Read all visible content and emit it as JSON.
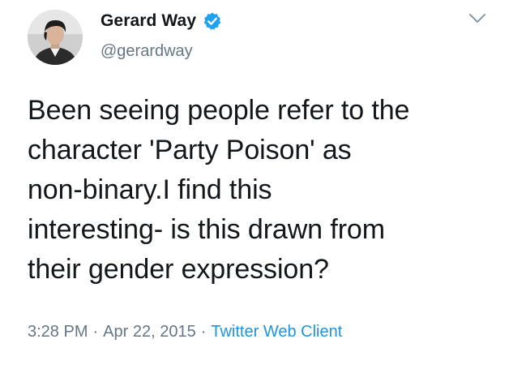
{
  "user": {
    "display_name": "Gerard Way",
    "handle": "@gerardway",
    "verified": true,
    "avatar_icon": "profile-photo"
  },
  "tweet": {
    "text": "Been seeing people refer to the\ncharacter 'Party Poison' as\nnon-binary.I find this\ninteresting- is this drawn from\ntheir gender expression?"
  },
  "meta": {
    "time": "3:28 PM",
    "separator": "·",
    "date": "Apr 22, 2015",
    "client": "Twitter Web Client"
  },
  "icons": {
    "verified": "verified-badge-icon",
    "more": "chevron-down-icon"
  },
  "colors": {
    "verified_blue": "#1da1f2",
    "link_blue": "#1b95e0",
    "secondary_text": "#657786",
    "primary_text": "#14171a"
  }
}
